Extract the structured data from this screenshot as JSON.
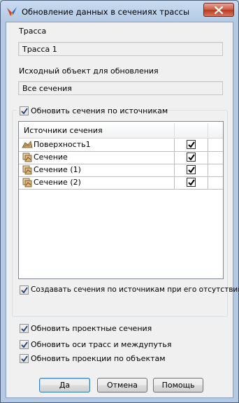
{
  "window": {
    "title": "Обновление данных в сечениях трассы"
  },
  "route": {
    "label": "Трасса",
    "value": "Трасса 1"
  },
  "source_object": {
    "label": "Исходный объект для обновления",
    "value": "Все сечения"
  },
  "update_by_sources": {
    "label": "Обновить сечения по источникам",
    "checked": true,
    "table": {
      "column_header": "Источники сечения",
      "rows": [
        {
          "label": "Поверхность1",
          "icon": "surface-icon",
          "checked": true
        },
        {
          "label": "Сечение",
          "icon": "section-icon",
          "checked": true
        },
        {
          "label": "Сечение (1)",
          "icon": "section-icon",
          "checked": true
        },
        {
          "label": "Сечение (2)",
          "icon": "section-icon",
          "checked": true
        }
      ]
    },
    "create_if_missing": {
      "label": "Создавать сечения по источникам при его отсутствии",
      "checked": true
    }
  },
  "options": [
    {
      "label": "Обновить проектные сечения",
      "checked": true
    },
    {
      "label": "Обновить оси трасс и междупутья",
      "checked": true
    },
    {
      "label": "Обновить проекции по объектам",
      "checked": true
    }
  ],
  "buttons": {
    "ok": "Да",
    "cancel": "Отмена",
    "help": "Помощь"
  }
}
